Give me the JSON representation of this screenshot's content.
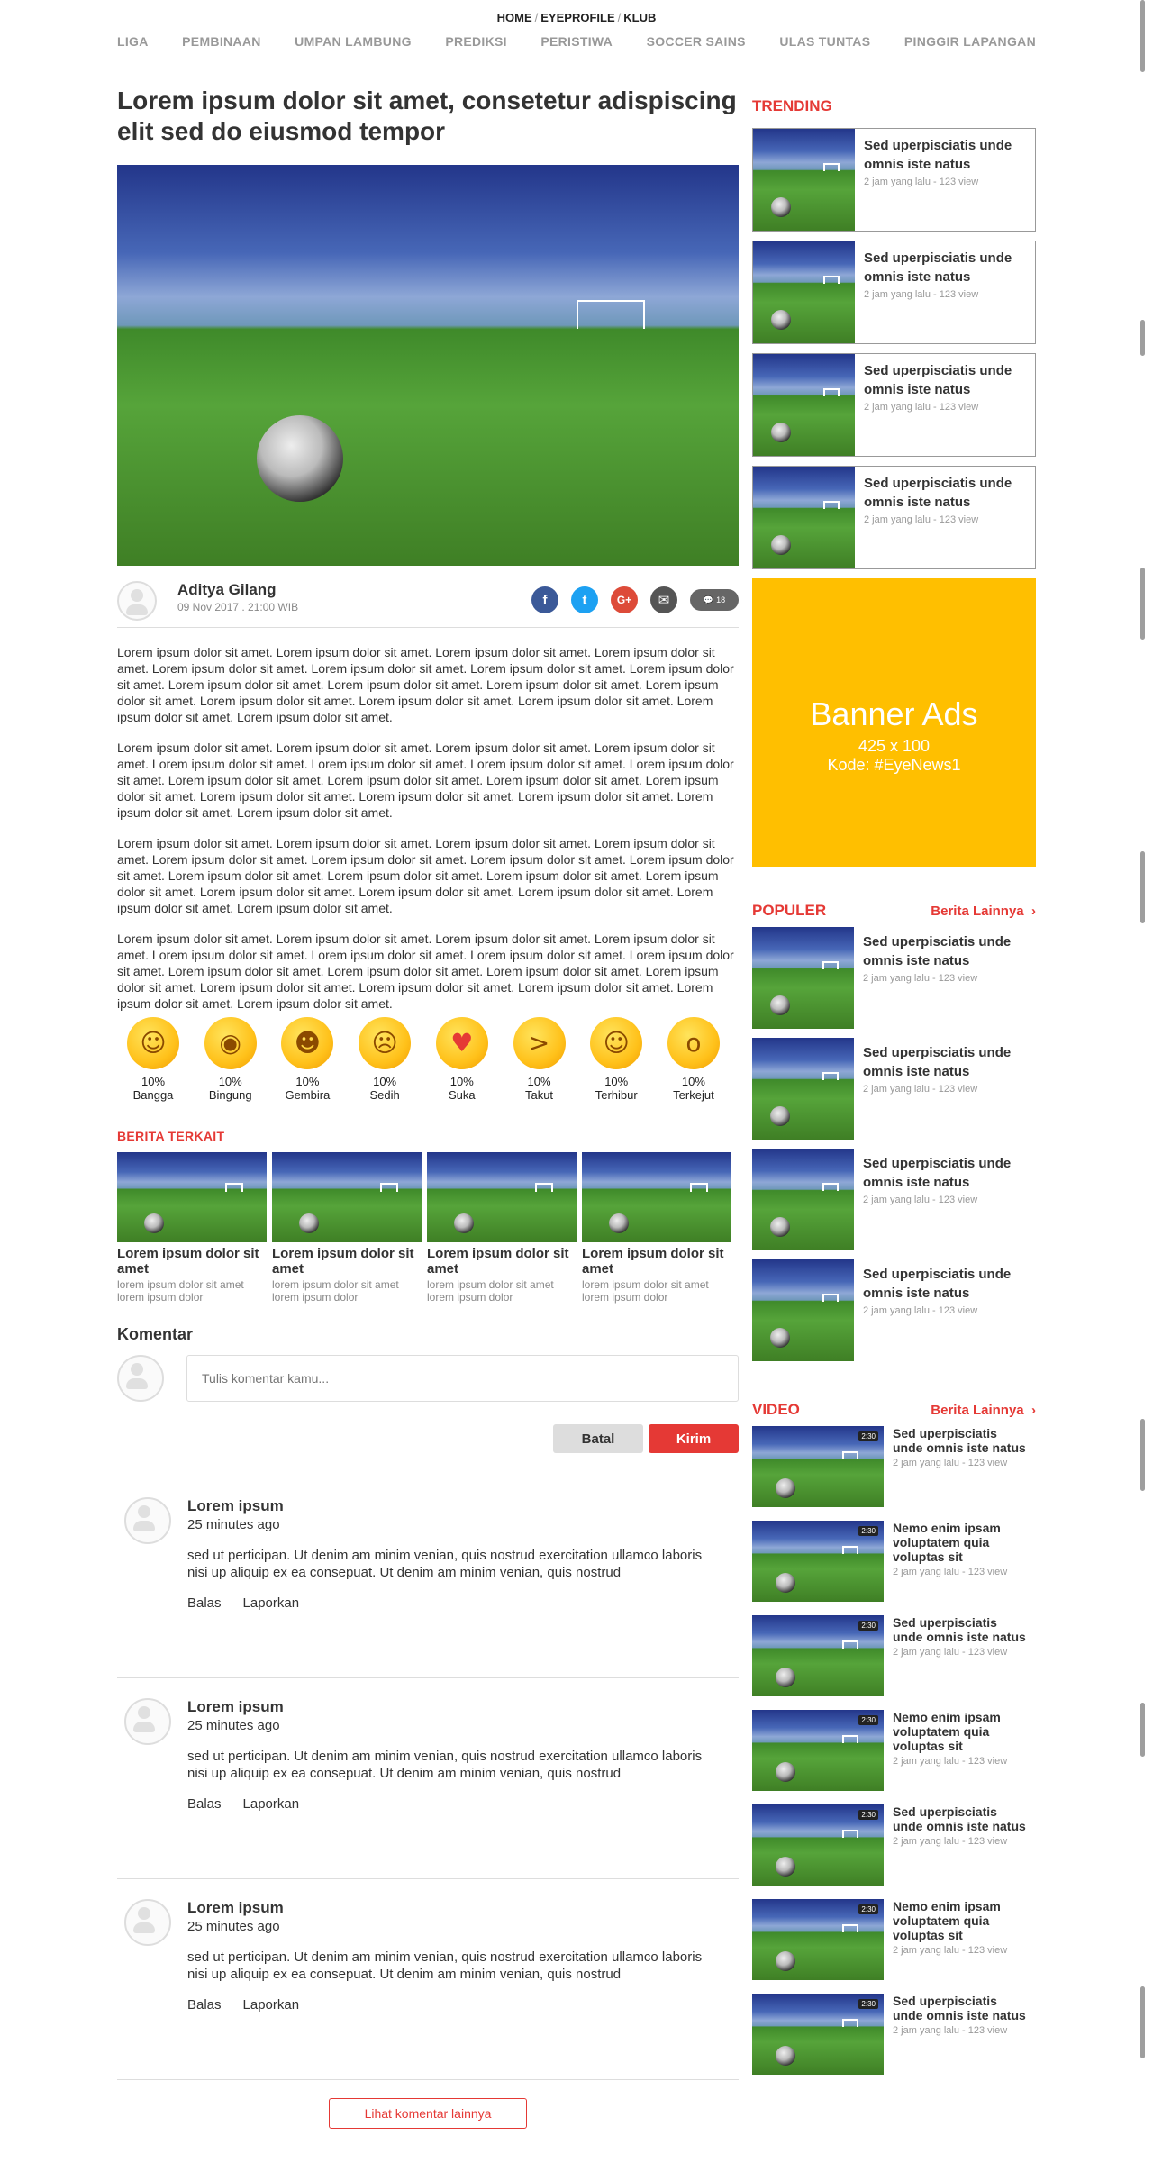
{
  "breadcrumb": [
    "HOME",
    "EYEPROFILE",
    "KLUB"
  ],
  "nav": [
    "LIGA",
    "PEMBINAAN",
    "UMPAN LAMBUNG",
    "PREDIKSI",
    "PERISTIWA",
    "SOCCER SAINS",
    "ULAS TUNTAS",
    "PINGGIR LAPANGAN"
  ],
  "article": {
    "title": "Lorem ipsum dolor sit amet, consetetur adispiscing elit sed do eiusmod tempor",
    "author": "Aditya Gilang",
    "date": "09 Nov 2017 . 21:00 WIB",
    "comment_count": "18",
    "paragraphs": [
      "Lorem ipsum dolor sit amet. Lorem ipsum dolor sit amet. Lorem ipsum dolor sit amet. Lorem ipsum dolor sit amet. Lorem ipsum dolor sit amet. Lorem ipsum dolor sit amet. Lorem ipsum dolor sit amet. Lorem ipsum dolor sit amet. Lorem ipsum dolor sit amet. Lorem ipsum dolor sit amet. Lorem ipsum dolor sit amet. Lorem ipsum dolor sit amet. Lorem ipsum dolor sit amet. Lorem ipsum dolor sit amet. Lorem ipsum dolor sit amet. Lorem ipsum dolor sit amet. Lorem ipsum dolor sit amet.",
      "Lorem ipsum dolor sit amet. Lorem ipsum dolor sit amet. Lorem ipsum dolor sit amet. Lorem ipsum dolor sit amet. Lorem ipsum dolor sit amet. Lorem ipsum dolor sit amet. Lorem ipsum dolor sit amet. Lorem ipsum dolor sit amet. Lorem ipsum dolor sit amet. Lorem ipsum dolor sit amet. Lorem ipsum dolor sit amet. Lorem ipsum dolor sit amet. Lorem ipsum dolor sit amet. Lorem ipsum dolor sit amet. Lorem ipsum dolor sit amet. Lorem ipsum dolor sit amet. Lorem ipsum dolor sit amet.",
      "Lorem ipsum dolor sit amet. Lorem ipsum dolor sit amet. Lorem ipsum dolor sit amet. Lorem ipsum dolor sit amet. Lorem ipsum dolor sit amet. Lorem ipsum dolor sit amet. Lorem ipsum dolor sit amet. Lorem ipsum dolor sit amet. Lorem ipsum dolor sit amet. Lorem ipsum dolor sit amet. Lorem ipsum dolor sit amet. Lorem ipsum dolor sit amet. Lorem ipsum dolor sit amet. Lorem ipsum dolor sit amet. Lorem ipsum dolor sit amet. Lorem ipsum dolor sit amet. Lorem ipsum dolor sit amet.",
      "Lorem ipsum dolor sit amet. Lorem ipsum dolor sit amet. Lorem ipsum dolor sit amet. Lorem ipsum dolor sit amet. Lorem ipsum dolor sit amet. Lorem ipsum dolor sit amet. Lorem ipsum dolor sit amet. Lorem ipsum dolor sit amet. Lorem ipsum dolor sit amet. Lorem ipsum dolor sit amet. Lorem ipsum dolor sit amet. Lorem ipsum dolor sit amet. Lorem ipsum dolor sit amet. Lorem ipsum dolor sit amet. Lorem ipsum dolor sit amet. Lorem ipsum dolor sit amet. Lorem ipsum dolor sit amet."
    ]
  },
  "share": [
    {
      "icon": "facebook-icon",
      "glyph": "f",
      "color": "#3b5998"
    },
    {
      "icon": "twitter-icon",
      "glyph": "t",
      "color": "#1da1f2"
    },
    {
      "icon": "google-plus-icon",
      "glyph": "G+",
      "color": "#dd4b39"
    },
    {
      "icon": "email-icon",
      "glyph": "✉",
      "color": "#555555"
    }
  ],
  "reactions": [
    {
      "pct": "10%",
      "label": "Bangga",
      "glyph": "☺"
    },
    {
      "pct": "10%",
      "label": "Bingung",
      "glyph": "◉"
    },
    {
      "pct": "10%",
      "label": "Gembira",
      "glyph": "☻"
    },
    {
      "pct": "10%",
      "label": "Sedih",
      "glyph": "☹"
    },
    {
      "pct": "10%",
      "label": "Suka",
      "glyph": "♥"
    },
    {
      "pct": "10%",
      "label": "Takut",
      "glyph": ">"
    },
    {
      "pct": "10%",
      "label": "Terhibur",
      "glyph": "☺"
    },
    {
      "pct": "10%",
      "label": "Terkejut",
      "glyph": "o"
    }
  ],
  "related": {
    "heading": "BERITA TERKAIT",
    "items": [
      {
        "title": "Lorem ipsum dolor sit amet",
        "desc": "lorem ipsum dolor sit amet lorem ipsum dolor"
      },
      {
        "title": "Lorem ipsum dolor sit amet",
        "desc": "lorem ipsum dolor sit amet lorem ipsum dolor"
      },
      {
        "title": "Lorem ipsum dolor sit amet",
        "desc": "lorem ipsum dolor sit amet lorem ipsum dolor"
      },
      {
        "title": "Lorem ipsum dolor sit amet",
        "desc": "lorem ipsum dolor sit amet lorem ipsum dolor"
      }
    ]
  },
  "comments": {
    "heading": "Komentar",
    "placeholder": "Tulis komentar kamu...",
    "cancel": "Batal",
    "submit": "Kirim",
    "reply": "Balas",
    "report": "Laporkan",
    "more": "Lihat komentar lainnya",
    "items": [
      {
        "name": "Lorem ipsum",
        "time": "25 minutes ago",
        "text": "sed ut perticipan. Ut denim am minim venian, quis nostrud exercitation ullamco laboris nisi up aliquip ex ea consepuat. Ut denim am minim venian, quis nostrud"
      },
      {
        "name": "Lorem ipsum",
        "time": "25 minutes ago",
        "text": "sed ut perticipan. Ut denim am minim venian, quis nostrud exercitation ullamco laboris nisi up aliquip ex ea consepuat. Ut denim am minim venian, quis nostrud"
      },
      {
        "name": "Lorem ipsum",
        "time": "25 minutes ago",
        "text": "sed ut perticipan. Ut denim am minim venian, quis nostrud exercitation ullamco laboris nisi up aliquip ex ea consepuat. Ut denim am minim venian, quis nostrud"
      }
    ]
  },
  "trending": {
    "heading": "TRENDING",
    "items": [
      {
        "title": "Sed uperpisciatis unde omnis iste natus",
        "meta": "2 jam yang lalu  -  123 view"
      },
      {
        "title": "Sed uperpisciatis unde omnis iste natus",
        "meta": "2 jam yang lalu  -  123 view"
      },
      {
        "title": "Sed uperpisciatis unde omnis iste natus",
        "meta": "2 jam yang lalu  -  123 view"
      },
      {
        "title": "Sed uperpisciatis unde omnis iste natus",
        "meta": "2 jam yang lalu  -  123 view"
      }
    ]
  },
  "banner": {
    "title": "Banner Ads",
    "size": "425 x 100",
    "code": "Kode: #EyeNews1",
    "color": "#ffbf00"
  },
  "populer": {
    "heading": "POPULER",
    "more": "Berita Lainnya",
    "items": [
      {
        "title": "Sed uperpisciatis unde omnis iste natus",
        "meta": "2 jam yang lalu  -  123 view"
      },
      {
        "title": "Sed uperpisciatis unde omnis iste natus",
        "meta": "2 jam yang lalu  -  123 view"
      },
      {
        "title": "Sed uperpisciatis unde omnis iste natus",
        "meta": "2 jam yang lalu  -  123 view"
      },
      {
        "title": "Sed uperpisciatis unde omnis iste natus",
        "meta": "2 jam yang lalu  -  123 view"
      }
    ]
  },
  "video": {
    "heading": "VIDEO",
    "more": "Berita Lainnya",
    "items": [
      {
        "duration": "2:30",
        "title": "Sed uperpisciatis unde omnis iste natus",
        "meta": "2 jam yang lalu  -  123 view"
      },
      {
        "duration": "2:30",
        "title": "Nemo enim ipsam voluptatem quia voluptas sit",
        "meta": "2 jam yang lalu  -  123 view"
      },
      {
        "duration": "2:30",
        "title": "Sed uperpisciatis unde omnis iste natus",
        "meta": "2 jam yang lalu  -  123 view"
      },
      {
        "duration": "2:30",
        "title": "Nemo enim ipsam voluptatem quia voluptas sit",
        "meta": "2 jam yang lalu  -  123 view"
      },
      {
        "duration": "2:30",
        "title": "Sed uperpisciatis unde omnis iste natus",
        "meta": "2 jam yang lalu  -  123 view"
      },
      {
        "duration": "2:30",
        "title": "Nemo enim ipsam voluptatem quia voluptas sit",
        "meta": "2 jam yang lalu  -  123 view"
      },
      {
        "duration": "2:30",
        "title": "Sed uperpisciatis unde omnis iste natus",
        "meta": "2 jam yang lalu  -  123 view"
      }
    ]
  },
  "colors": {
    "accent": "#e53935",
    "banner": "#ffbf00"
  }
}
